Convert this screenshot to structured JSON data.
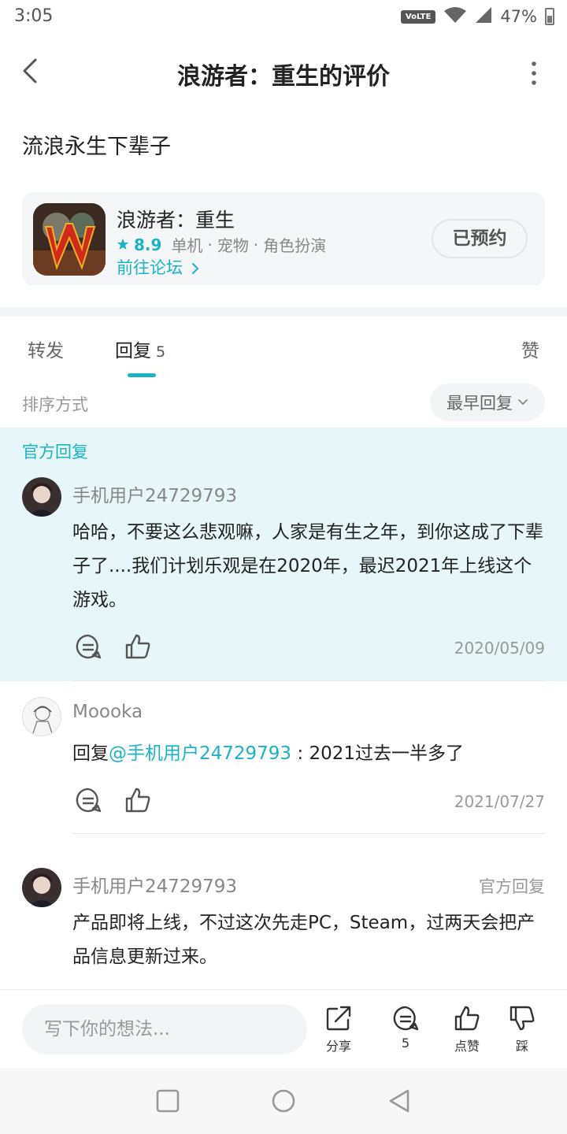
{
  "status": {
    "time": "3:05",
    "volte": "VoLTE",
    "battery": "47%"
  },
  "header": {
    "title": "浪游者：重生的评价"
  },
  "review": {
    "text": "流浪永生下辈子"
  },
  "game": {
    "name": "浪游者：重生",
    "rating": "8.9",
    "tags": [
      "单机",
      "宠物",
      "角色扮演"
    ],
    "forum_link": "前往论坛",
    "reserved_label": "已预约"
  },
  "tabs": {
    "forward": "转发",
    "reply": "回复",
    "reply_count": "5",
    "like": "赞"
  },
  "sort": {
    "label": "排序方式",
    "value": "最早回复"
  },
  "official_tag": "官方回复",
  "comments": [
    {
      "user": "手机用户24729793",
      "text": "哈哈，不要这么悲观嘛，人家是有生之年，到你这成了下辈子了....我们计划乐观是在2020年，最迟2021年上线这个游戏。",
      "date": "2020/05/09"
    },
    {
      "user": "Moooka",
      "reply_prefix": "回复",
      "mention": "@手机用户24729793",
      "text": " : 2021过去一半多了",
      "date": "2021/07/27"
    },
    {
      "user": "手机用户24729793",
      "badge": "官方回复",
      "text": "产品即将上线，不过这次先走PC，Steam，过两天会把产品信息更新过来。"
    }
  ],
  "bottom": {
    "placeholder": "写下你的想法...",
    "share": "分享",
    "comment_count": "5",
    "like": "点赞",
    "dislike": "踩"
  },
  "colors": {
    "accent": "#19b4c4",
    "official_bg": "#e6f6f9"
  }
}
